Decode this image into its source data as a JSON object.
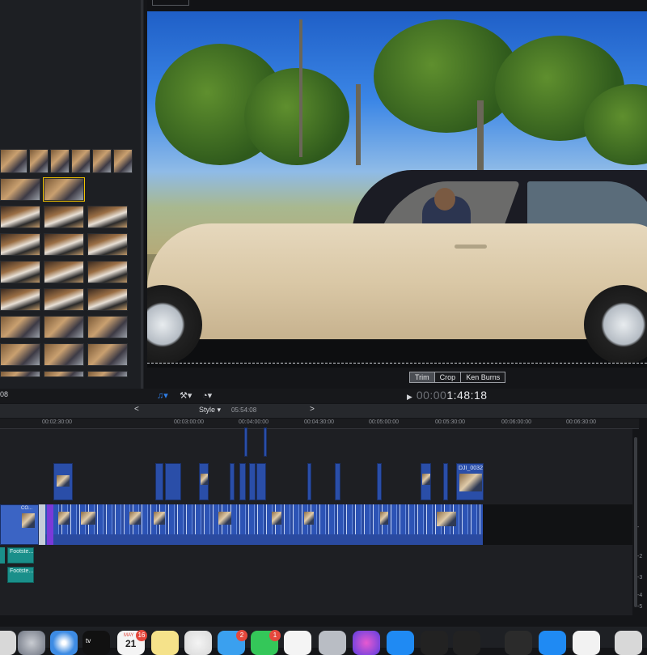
{
  "viewer": {
    "controls": [
      "Trim",
      "Crop",
      "Ken Burns"
    ],
    "active_control": "Trim"
  },
  "toolbar": {
    "timecode_dim": "00:00",
    "timecode": "1:48:18",
    "left_timecode": "08",
    "music_icon": "music-note-icon",
    "tools_icon": "tools-icon",
    "speed_icon": "speedometer-icon"
  },
  "index_bar": {
    "prev": "<",
    "next": ">",
    "style_label": "Style",
    "duration": "05:54:08"
  },
  "ruler": {
    "labels": [
      "00:02:30:00",
      "00:03:00:00",
      "00:03:30:00",
      "00:04:00:00",
      "00:04:30:00",
      "00:05:00:00",
      "00:05:30:00",
      "00:06:00:00",
      "00:06:30:00"
    ]
  },
  "timeline": {
    "clip_label_co": "CO...",
    "clip_label_dji": "DJI_0032",
    "audio_clips": [
      "Footste...",
      "Footste..."
    ],
    "right_numbers": [
      "-",
      "-2",
      "-3",
      "-4",
      "-5"
    ]
  },
  "dock": {
    "calendar_month": "MAY",
    "calendar_day": "21",
    "tv_label": "tv",
    "badges": [
      "16",
      "2",
      "1"
    ]
  },
  "colors": {
    "accent": "#2f7fe8",
    "clip_blue": "#2a4ea8",
    "audio_teal": "#1a8f8a",
    "badge_red": "#e5483d"
  }
}
